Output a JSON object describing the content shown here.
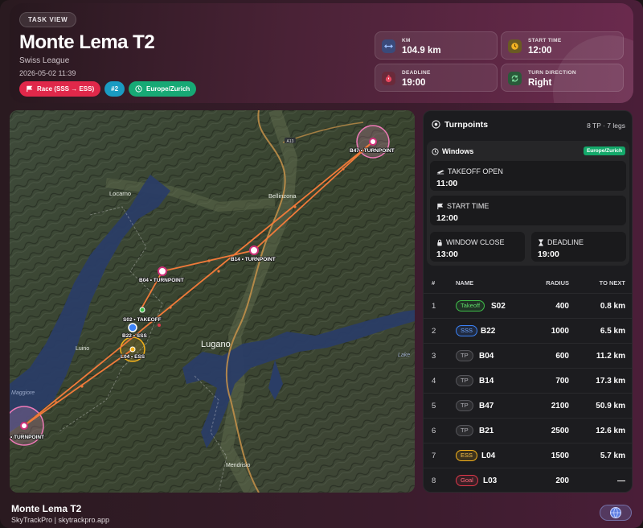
{
  "header": {
    "pill": "TASK VIEW",
    "title": "Monte Lema T2",
    "league": "Swiss League",
    "datetime": "2026-05-02 11:39",
    "tags": {
      "race": "Race (SSS → ESS)",
      "number": "#2",
      "timezone": "Europe/Zurich"
    },
    "stats": {
      "km": {
        "label": "KM",
        "value": "104.9 km",
        "icon": "arrows-horizontal-icon"
      },
      "start_time": {
        "label": "START TIME",
        "value": "12:00",
        "icon": "clock-icon"
      },
      "deadline": {
        "label": "DEADLINE",
        "value": "19:00",
        "icon": "stopwatch-icon"
      },
      "turn_direction": {
        "label": "TURN DIRECTION",
        "value": "Right",
        "icon": "rotate-icon"
      }
    }
  },
  "map": {
    "place_labels": {
      "bellinzona": "Bellinzona",
      "locarno": "Locarno",
      "lugano": "Lugano",
      "luino": "Luino",
      "maggiore": "Maggiore",
      "mendrisio": "Mendrisio",
      "lake": "Lake",
      "road": "A13"
    },
    "waypoints": {
      "b47": "B47 • TURNPOINT",
      "b14": "B14 • TURNPOINT",
      "b04": "B04 • TURNPOINT",
      "s02": "S02 • TAKEOFF",
      "b22": "B22 • SSS",
      "l04": "L04 • ESS",
      "b21": "• TURNPOINT"
    }
  },
  "panel": {
    "title": "Turnpoints",
    "meta": "8 TP · 7 legs",
    "windows": {
      "title": "Windows",
      "timezone": "Europe/Zurich",
      "takeoff_open": {
        "label": "TAKEOFF OPEN",
        "value": "11:00"
      },
      "start_time": {
        "label": "START TIME",
        "value": "12:00"
      },
      "window_close": {
        "label": "WINDOW CLOSE",
        "value": "13:00"
      },
      "deadline": {
        "label": "DEADLINE",
        "value": "19:00"
      }
    },
    "table": {
      "headers": {
        "num": "#",
        "name": "NAME",
        "radius": "RADIUS",
        "next": "TO NEXT"
      },
      "rows": [
        {
          "num": "1",
          "type": "Takeoff",
          "name": "S02",
          "radius": "400",
          "next": "0.8 km"
        },
        {
          "num": "2",
          "type": "SSS",
          "name": "B22",
          "radius": "1000",
          "next": "6.5 km"
        },
        {
          "num": "3",
          "type": "TP",
          "name": "B04",
          "radius": "600",
          "next": "11.2 km"
        },
        {
          "num": "4",
          "type": "TP",
          "name": "B14",
          "radius": "700",
          "next": "17.3 km"
        },
        {
          "num": "5",
          "type": "TP",
          "name": "B47",
          "radius": "2100",
          "next": "50.9 km"
        },
        {
          "num": "6",
          "type": "TP",
          "name": "B21",
          "radius": "2500",
          "next": "12.6 km"
        },
        {
          "num": "7",
          "type": "ESS",
          "name": "L04",
          "radius": "1500",
          "next": "5.7 km"
        },
        {
          "num": "8",
          "type": "Goal",
          "name": "L03",
          "radius": "200",
          "next": "—"
        }
      ]
    }
  },
  "footer": {
    "title": "Monte Lema T2",
    "subtitle": "SkyTrackPro | skytrackpro.app"
  },
  "colors": {
    "race": "#e0284a",
    "number": "#1a9bc2",
    "timezone": "#17a975",
    "route": "#f07a3a",
    "takeoff": "#3fbf4a",
    "sss": "#3b82f6",
    "tp": "#8a8a90",
    "ess": "#f5b21a",
    "goal": "#e0384a"
  }
}
